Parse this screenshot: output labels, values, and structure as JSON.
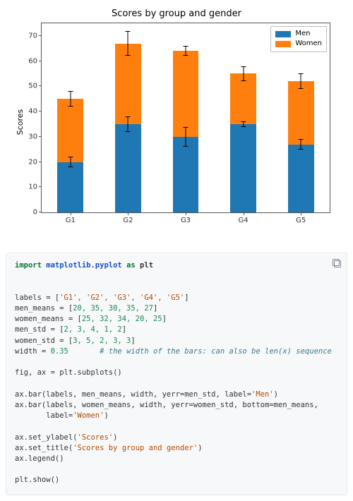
{
  "chart_data": {
    "type": "bar",
    "stacked": true,
    "categories": [
      "G1",
      "G2",
      "G3",
      "G4",
      "G5"
    ],
    "series": [
      {
        "name": "Men",
        "values": [
          20,
          35,
          30,
          35,
          27
        ],
        "err": [
          2,
          3,
          4,
          1,
          2
        ],
        "color": "#1f77b4"
      },
      {
        "name": "Women",
        "values": [
          25,
          32,
          34,
          20,
          25
        ],
        "err": [
          3,
          5,
          2,
          3,
          3
        ],
        "color": "#ff7f0e"
      }
    ],
    "title": "Scores by group and gender",
    "xlabel": "",
    "ylabel": "Scores",
    "ylim": [
      0,
      75
    ],
    "yticks": [
      0,
      10,
      20,
      30,
      40,
      50,
      60,
      70
    ],
    "legend_position": "upper right",
    "bar_width": 0.35
  },
  "legend": {
    "items": [
      {
        "label": "Men",
        "color": "#1f77b4"
      },
      {
        "label": "Women",
        "color": "#ff7f0e"
      }
    ]
  },
  "code": {
    "l1a": "import",
    "l1b": "matplotlib.pyplot",
    "l1c": "as",
    "l1d": "plt",
    "l2": "labels = [",
    "l2v": [
      "'G1'",
      "'G2'",
      "'G3'",
      "'G4'",
      "'G5'"
    ],
    "l3": "men_means = [",
    "l3v": [
      "20",
      "35",
      "30",
      "35",
      "27"
    ],
    "l4": "women_means = [",
    "l4v": [
      "25",
      "32",
      "34",
      "20",
      "25"
    ],
    "l5": "men_std = [",
    "l5v": [
      "2",
      "3",
      "4",
      "1",
      "2"
    ],
    "l6": "women_std = [",
    "l6v": [
      "3",
      "5",
      "2",
      "3",
      "3"
    ],
    "l7a": "width = ",
    "l7b": "0.35",
    "l7c": "# the width of the bars: can also be len(x) sequence",
    "l8": "fig, ax = plt.subplots()",
    "l9a": "ax.bar(labels, men_means, width, yerr=men_std, label=",
    "l9b": "'Men'",
    "l9c": ")",
    "l10a": "ax.bar(labels, women_means, width, yerr=women_std, bottom=men_means,",
    "l10b": "       label=",
    "l10c": "'Women'",
    "l10d": ")",
    "l11a": "ax.set_ylabel(",
    "l11b": "'Scores'",
    "l11c": ")",
    "l12a": "ax.set_title(",
    "l12b": "'Scores by group and gender'",
    "l12c": ")",
    "l13": "ax.legend()",
    "l14": "plt.show()"
  }
}
